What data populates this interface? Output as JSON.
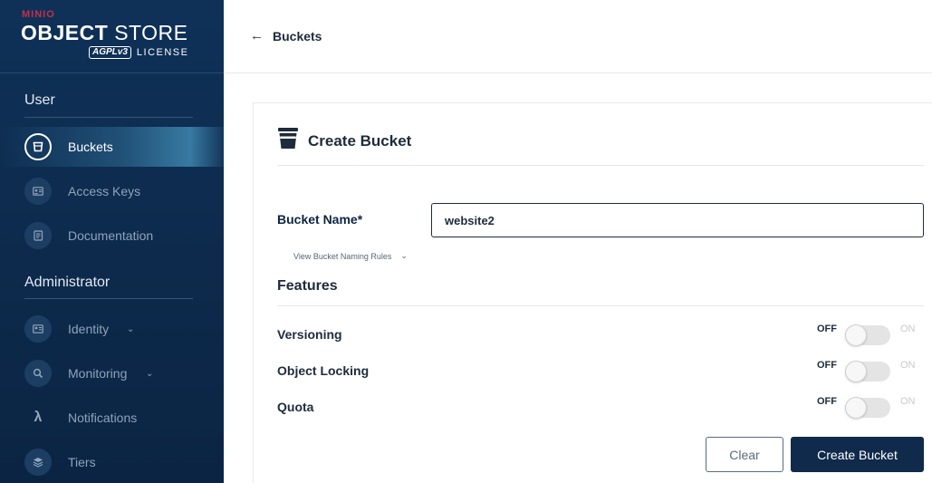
{
  "brand": {
    "vendor": "MINIO",
    "product_bold": "OBJECT",
    "product_thin": "STORE",
    "agpl": "AGPLv3",
    "license": "LICENSE"
  },
  "sidebar": {
    "user_section": "User",
    "admin_section": "Administrator",
    "user_items": [
      {
        "label": "Buckets",
        "icon": "bucket-icon",
        "active": true
      },
      {
        "label": "Access Keys",
        "icon": "key-icon"
      },
      {
        "label": "Documentation",
        "icon": "document-icon"
      }
    ],
    "admin_items": [
      {
        "label": "Identity",
        "icon": "identity-icon",
        "expandable": true
      },
      {
        "label": "Monitoring",
        "icon": "monitoring-icon",
        "expandable": true
      },
      {
        "label": "Notifications",
        "icon": "lambda-icon"
      },
      {
        "label": "Tiers",
        "icon": "tiers-icon"
      }
    ]
  },
  "header": {
    "back_label": "Buckets"
  },
  "form": {
    "title": "Create Bucket",
    "bucket_name_label": "Bucket Name*",
    "bucket_name_value": "website2",
    "naming_rules": "View Bucket Naming Rules",
    "features_title": "Features",
    "features": [
      {
        "label": "Versioning",
        "off": "OFF",
        "on": "ON",
        "enabled": false
      },
      {
        "label": "Object Locking",
        "off": "OFF",
        "on": "ON",
        "enabled": false
      },
      {
        "label": "Quota",
        "off": "OFF",
        "on": "ON",
        "enabled": false
      }
    ],
    "clear_label": "Clear",
    "create_label": "Create Bucket"
  },
  "colors": {
    "sidebar_bg": "#0f3158",
    "primary_button": "#0f2a4b",
    "brand_red": "#c72e49"
  }
}
